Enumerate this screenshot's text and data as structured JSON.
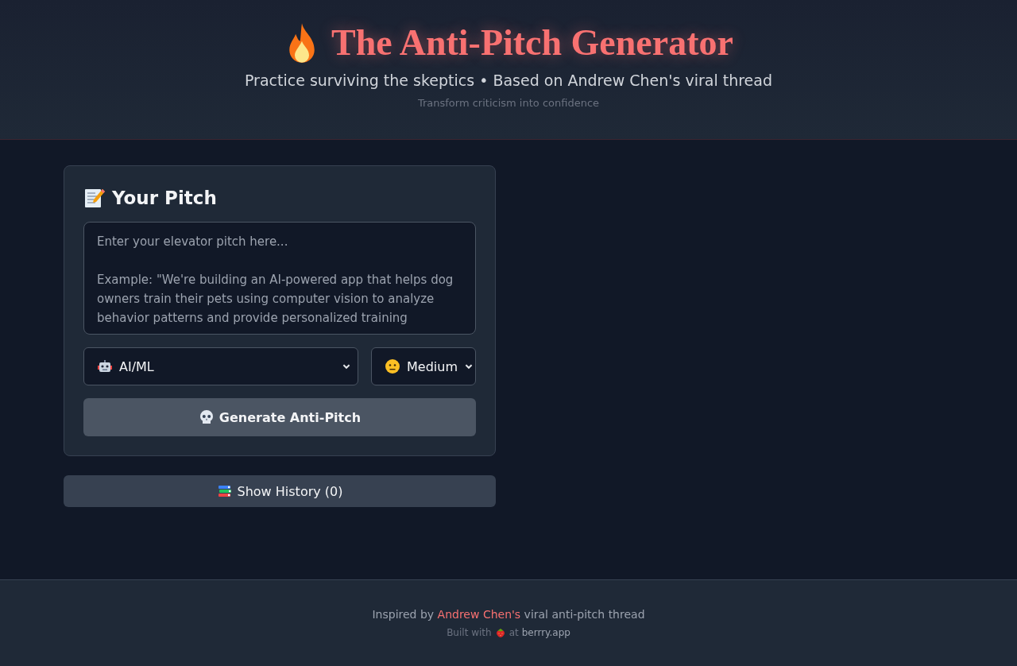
{
  "header": {
    "title": "The Anti-Pitch Generator",
    "subtitle": "Practice surviving the skeptics • Based on Andrew Chen's viral thread",
    "tagline": "Transform criticism into confidence"
  },
  "pitch_card": {
    "heading": "Your Pitch",
    "pitch_field": {
      "placeholder": "Enter your elevator pitch here...\n\nExample: \"We're building an AI-powered app that helps dog owners train their pets using computer vision to analyze behavior patterns and provide personalized training"
    },
    "category_select": {
      "value": "AI/ML"
    },
    "difficulty_select": {
      "value": "Medium"
    },
    "generate_button": {
      "label": "Generate Anti-Pitch"
    }
  },
  "history_button": {
    "label": "Show History (0)"
  },
  "footer": {
    "inspired_prefix": "Inspired by",
    "inspired_link": "Andrew Chen's",
    "inspired_suffix": "viral anti-pitch thread",
    "built_prefix": "Built with",
    "built_mid": "at",
    "built_link": "berrry.app"
  }
}
